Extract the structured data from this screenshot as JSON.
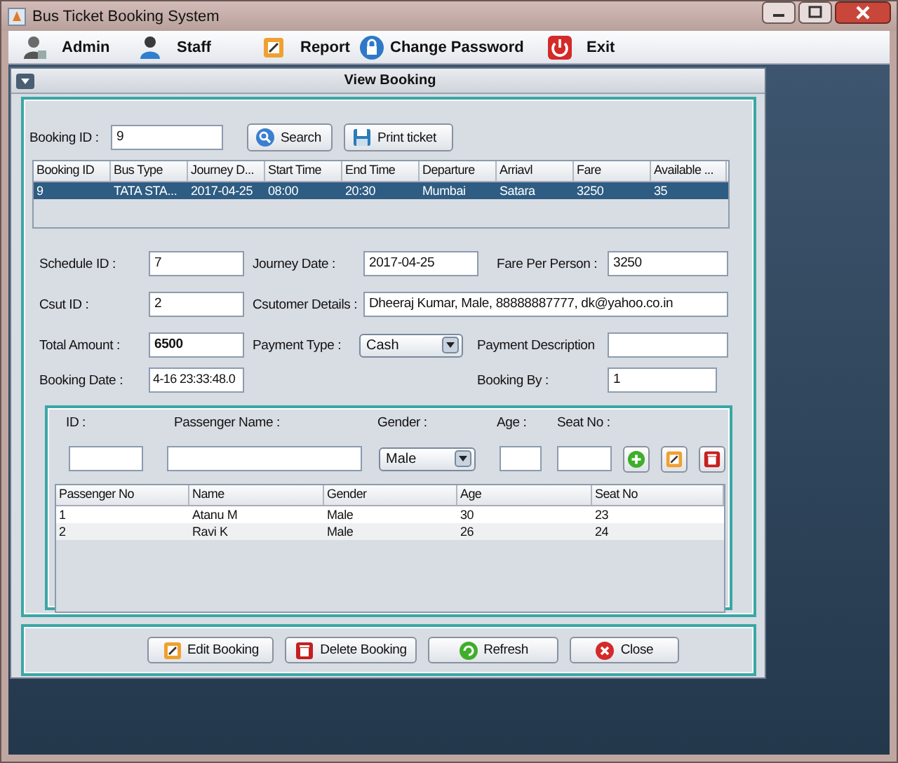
{
  "window": {
    "title": "Bus Ticket Booking System"
  },
  "menu": [
    {
      "label": "Admin",
      "kind": "admin"
    },
    {
      "label": "Staff",
      "kind": "staff"
    },
    {
      "label": "Report",
      "kind": "report"
    },
    {
      "label": "Change Password",
      "kind": "password"
    },
    {
      "label": "Exit",
      "kind": "exit"
    }
  ],
  "frame": {
    "title": "View Booking"
  },
  "search": {
    "label": "Booking ID :",
    "value": "9",
    "buttons": [
      {
        "label": "Search",
        "kind": "search"
      },
      {
        "label": "Print ticket",
        "kind": "print"
      }
    ]
  },
  "bookings_table": {
    "columns": [
      "Booking ID",
      "Bus Type",
      "Journey D...",
      "Start Time",
      "End Time",
      "Departure",
      "Arriavl",
      "Fare",
      "Available ..."
    ],
    "rows": [
      {
        "cells": [
          "9",
          "TATA STA...",
          "2017-04-25",
          "08:00",
          "20:30",
          "Mumbai",
          "Satara",
          "3250",
          "35"
        ],
        "selected": true
      }
    ]
  },
  "form": {
    "schedule_id": {
      "label": "Schedule ID :",
      "value": "7"
    },
    "journey_date": {
      "label": "Journey Date :",
      "value": "2017-04-25"
    },
    "fare_per_person": {
      "label": "Fare Per Person :",
      "value": "3250"
    },
    "cust_id": {
      "label": "Csut ID :",
      "value": "2"
    },
    "customer_details": {
      "label": "Csutomer Details :",
      "value": "Dheeraj Kumar, Male, 88888887777, dk@yahoo.co.in"
    },
    "total_amount": {
      "label": "Total Amount :",
      "value": "6500"
    },
    "payment_type": {
      "label": "Payment Type :",
      "value": "Cash"
    },
    "payment_description": {
      "label": "Payment Description"
    },
    "booking_date": {
      "label": "Booking Date :",
      "value": "4-16 23:33:48.0"
    },
    "booking_by": {
      "label": "Booking By :",
      "value": "1"
    }
  },
  "passenger_form": {
    "id_label": "ID :",
    "name_label": "Passenger Name :",
    "gender_label": "Gender :",
    "gender": "Male",
    "age_label": "Age :",
    "seat_label": "Seat No :"
  },
  "passengers_table": {
    "columns": [
      "Passenger No",
      "Name",
      "Gender",
      "Age",
      "Seat No"
    ],
    "rows": [
      {
        "cells": [
          "1",
          "Atanu M",
          "Male",
          "30",
          "23"
        ]
      },
      {
        "cells": [
          "2",
          "Ravi K",
          "Male",
          "26",
          "24"
        ]
      }
    ]
  },
  "footer_buttons": [
    {
      "label": "Edit Booking",
      "kind": "edit"
    },
    {
      "label": "Delete Booking",
      "kind": "delete"
    },
    {
      "label": "Refresh",
      "kind": "refresh"
    },
    {
      "label": "Close",
      "kind": "close"
    }
  ]
}
